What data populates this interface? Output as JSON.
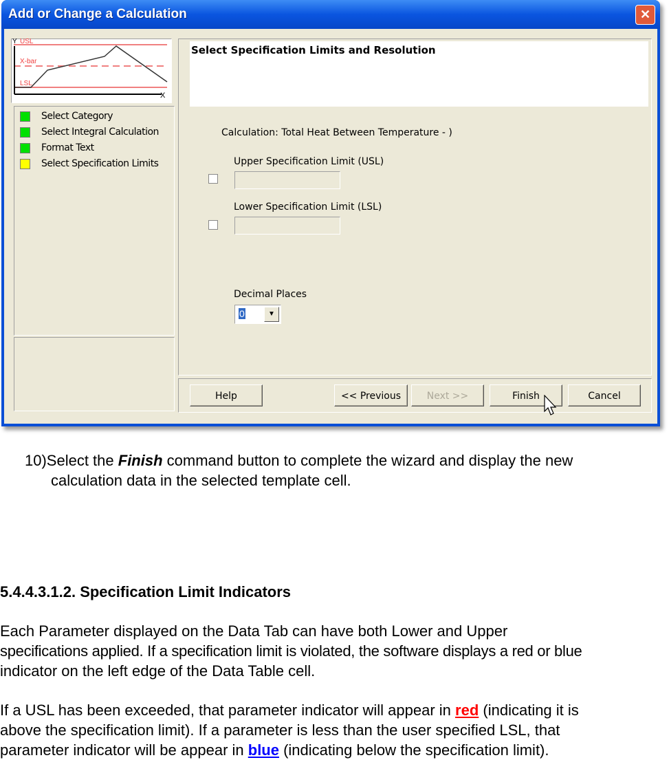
{
  "window": {
    "title": "Add or Change a Calculation",
    "close": "✕"
  },
  "preview": {
    "y": "Y",
    "x": "X",
    "usl": "USL",
    "xbar": "X-bar",
    "lsl": "LSL"
  },
  "steps": [
    {
      "label": "Select Category",
      "color": "#00E000"
    },
    {
      "label": "Select Integral Calculation",
      "color": "#00E000"
    },
    {
      "label": "Format Text",
      "color": "#00E000"
    },
    {
      "label": "Select Specification Limits",
      "color": "#FFFF00"
    }
  ],
  "panel": {
    "heading": "Select Specification Limits and Resolution",
    "calculation": "Calculation: Total Heat Between Temperature - )",
    "usl_label": "Upper Specification Limit (USL)",
    "usl_value": "",
    "usl_checked": false,
    "lsl_label": "Lower Specification Limit (LSL)",
    "lsl_value": "",
    "lsl_checked": false,
    "decimal_label": "Decimal Places",
    "decimal_value": "0"
  },
  "buttons": {
    "help": "Help",
    "previous": "<< Previous",
    "next": "Next >>",
    "finish": "Finish",
    "cancel": "Cancel"
  },
  "doc": {
    "step_num": "10)",
    "step_pre": "Select the ",
    "step_em": "Finish",
    "step_post": " command button to complete the wizard and display the new",
    "step_line2": "calculation data in the selected template cell.",
    "heading": "5.4.4.3.1.2. Specification Limit Indicators",
    "p1_l1": "Each Parameter displayed on the Data Tab can have both Lower and Upper",
    "p1_l2": "specifications applied. If a specification limit is violated, the software displays a red or blue",
    "p1_l3": "indicator on the left edge of the Data Table cell.",
    "p2_a": "If a USL has been exceeded, that parameter indicator will appear in ",
    "p2_red": "red",
    "p2_b": " (indicating it is",
    "p2_l2": "above the specification limit). If a parameter is less than the user specified LSL, that",
    "p2_c": "parameter indicator will be appear in ",
    "p2_blue": "blue",
    "p2_d": " (indicating below the specification limit)."
  }
}
